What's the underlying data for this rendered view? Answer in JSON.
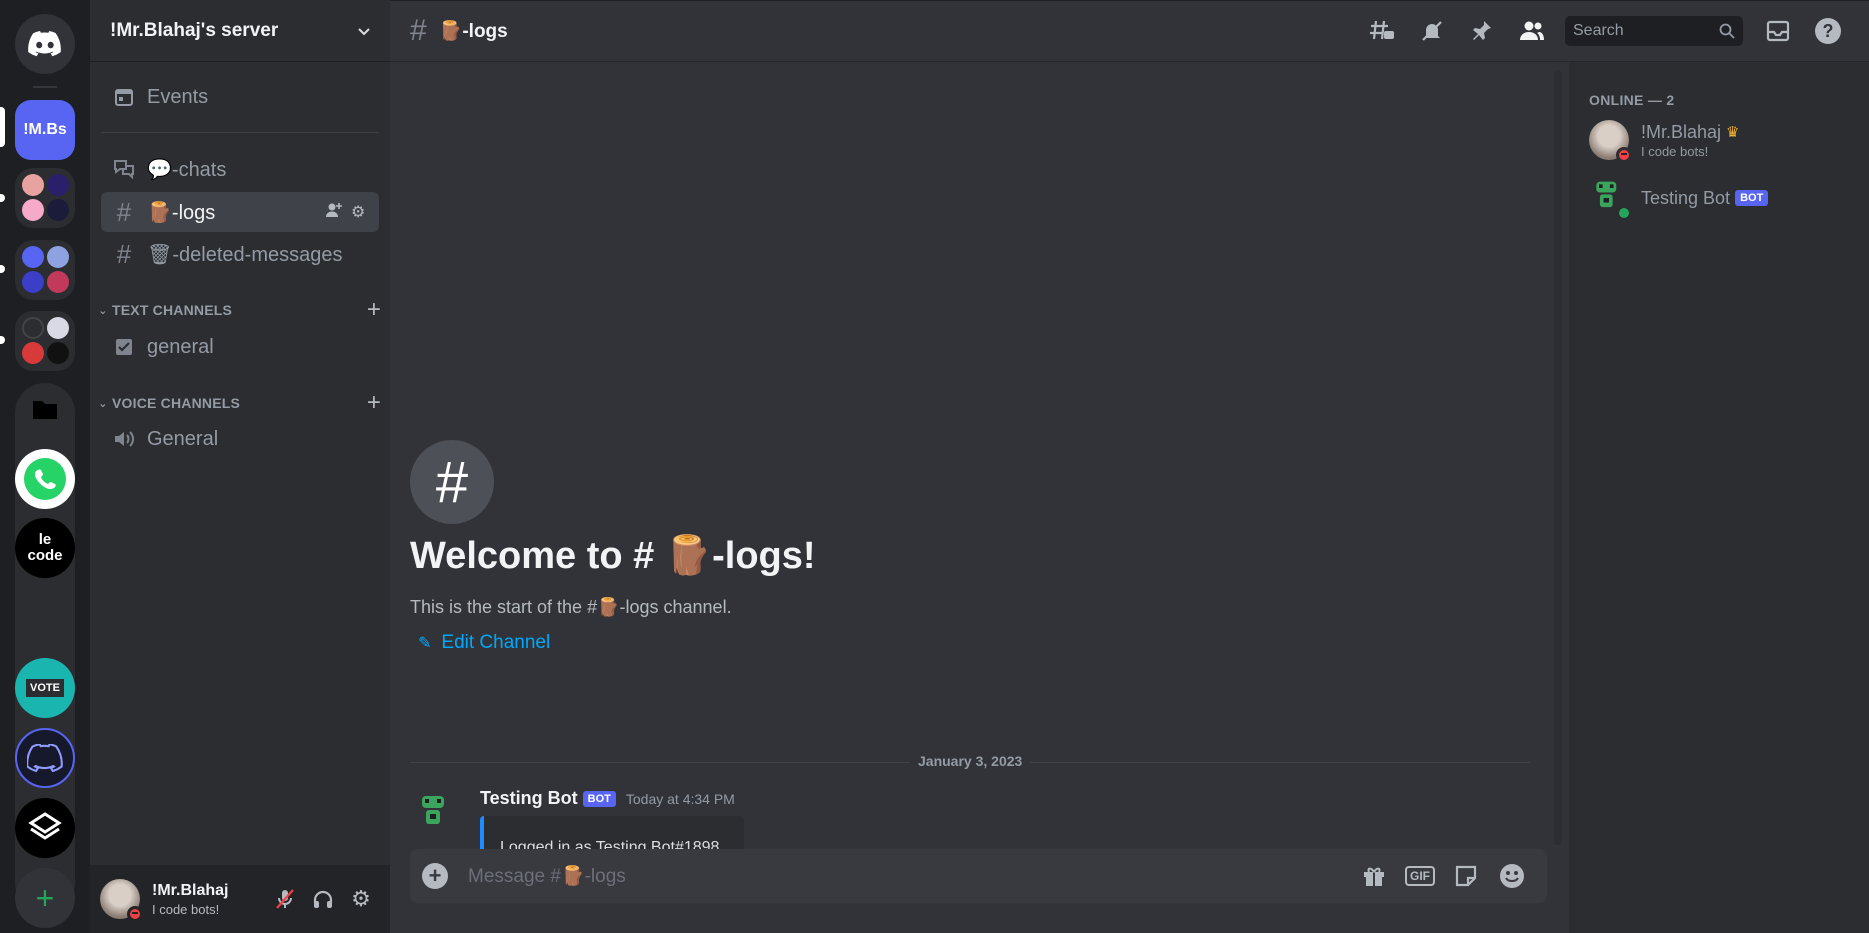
{
  "server": {
    "name": "!Mr.Blahaj's server",
    "rail_selected_abbr": "!M.Bs",
    "rail_text_server": "le code",
    "rail_vote_label": "VOTE"
  },
  "sidebar": {
    "events_label": "Events",
    "channels": [
      {
        "label": "💬-chats"
      },
      {
        "label": "🪵-logs"
      },
      {
        "label": "🗑-deleted-messages"
      }
    ],
    "text_category": "TEXT CHANNELS",
    "text_channels": [
      {
        "label": "general"
      }
    ],
    "voice_category": "VOICE CHANNELS",
    "voice_channels": [
      {
        "label": "General"
      }
    ]
  },
  "user": {
    "name": "!Mr.Blahaj",
    "status": "I code bots!"
  },
  "header": {
    "channel_name": "🪵-logs",
    "search_placeholder": "Search"
  },
  "welcome": {
    "title": "Welcome to # 🪵-logs!",
    "subtitle": "This is the start of the #🪵-logs channel.",
    "edit_label": "Edit Channel"
  },
  "messages": {
    "date_divider": "January 3, 2023",
    "items": [
      {
        "author": "Testing Bot",
        "tag": "BOT",
        "time": "Today at 4:34 PM",
        "embed_text": "Logged in as Testing Bot#1898"
      }
    ]
  },
  "composer": {
    "placeholder": "Message #🪵-logs",
    "gif_label": "GIF"
  },
  "members": {
    "category": "ONLINE — 2",
    "list": [
      {
        "name": "!Mr.Blahaj",
        "status": "I code bots!",
        "owner": true
      },
      {
        "name": "Testing Bot",
        "tag": "BOT"
      }
    ]
  },
  "colors": {
    "accent": "#5865f2",
    "link": "#00a8fc",
    "online": "#23a55a",
    "dnd": "#f23f43"
  }
}
